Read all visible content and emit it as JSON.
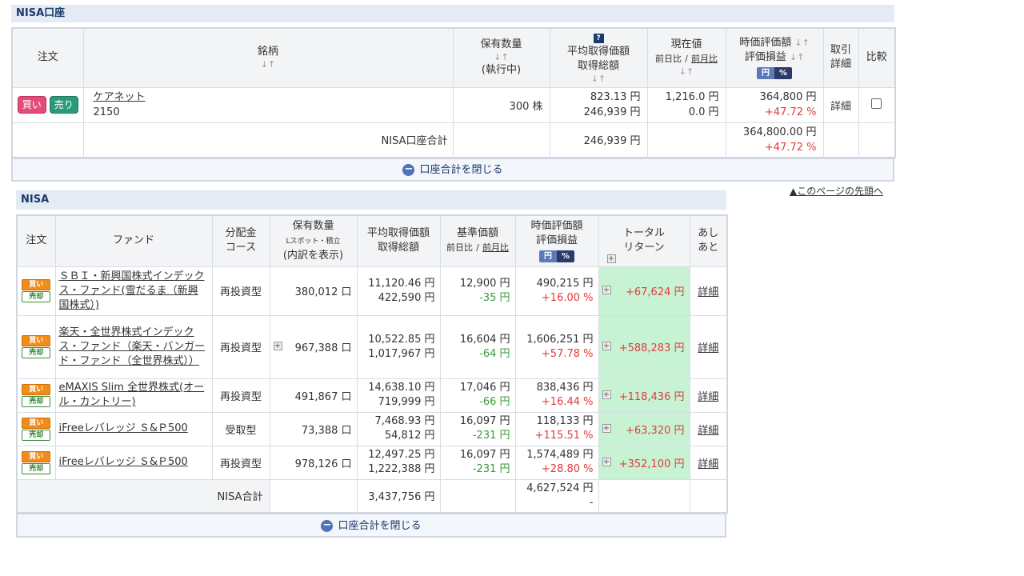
{
  "nisa_account": {
    "title": "NISA口座",
    "headers": {
      "order": "注文",
      "symbol": "銘柄",
      "holdings": "保有数量",
      "holdings_sub": "(執行中)",
      "avg_cost": "平均取得価額",
      "total_cost": "取得総額",
      "price": "現在値",
      "prev_day": "前日比",
      "prev_month": "前月比",
      "market_value": "時価評価額",
      "pl": "評価損益",
      "trade_detail": "取引詳細",
      "compare": "比較",
      "toggle_yen": "円",
      "toggle_pct": "%"
    },
    "row": {
      "buy": "買い",
      "sell": "売り",
      "name": "ケアネット",
      "code": "2150",
      "qty": "300 株",
      "avg": "823.13 円",
      "total": "246,939 円",
      "price": "1,216.0 円",
      "change": "0.0 円",
      "value": "364,800 円",
      "pl": "+47.72 %",
      "detail": "詳細"
    },
    "total_row": {
      "label": "NISA口座合計",
      "total": "246,939 円",
      "value": "364,800.00 円",
      "pl": "+47.72 %"
    },
    "close_label": "口座合計を閉じる",
    "page_top": "▲このページの先頭へ"
  },
  "nisa": {
    "title": "NISA",
    "headers": {
      "order": "注文",
      "fund": "ファンド",
      "dist_1": "分配金",
      "dist_2": "コース",
      "holdings": "保有数量",
      "holdings_sub": "Lスポット・積立",
      "holdings_detail": "(内訳を表示)",
      "avg_cost": "平均取得価額",
      "total_cost": "取得総額",
      "nav": "基準価額",
      "prev_day": "前日比",
      "prev_month": "前月比",
      "market_value": "時価評価額",
      "pl": "評価損益",
      "total_return_1": "トータル",
      "total_return_2": "リターン",
      "history_1": "あし",
      "history_2": "あと",
      "toggle_yen": "円",
      "toggle_pct": "%"
    },
    "buy_label": "買い",
    "sell_label": "売却",
    "detail_label": "詳細",
    "rows": [
      {
        "name": "ＳＢＩ・新興国株式インデックス・ファンド(雪だるま（新興国株式）)",
        "course": "再投資型",
        "qty": "380,012 口",
        "avg": "11,120.46 円",
        "total": "422,590 円",
        "nav": "12,900 円",
        "change": "-35 円",
        "value": "490,215 円",
        "pl": "+16.00 %",
        "ret": "+67,624 円"
      },
      {
        "name": "楽天・全世界株式インデックス・ファンド（楽天・バンガード・ファンド（全世界株式））",
        "course": "再投資型",
        "qty": "967,388 口",
        "avg": "10,522.85 円",
        "total": "1,017,967 円",
        "nav": "16,604 円",
        "change": "-64 円",
        "value": "1,606,251 円",
        "pl": "+57.78 %",
        "ret": "+588,283 円"
      },
      {
        "name": "eMAXIS Slim 全世界株式(オール・カントリー)",
        "course": "再投資型",
        "qty": "491,867 口",
        "avg": "14,638.10 円",
        "total": "719,999 円",
        "nav": "17,046 円",
        "change": "-66 円",
        "value": "838,436 円",
        "pl": "+16.44 %",
        "ret": "+118,436 円"
      },
      {
        "name": "iFreeレバレッジ Ｓ&Ｐ500",
        "course": "受取型",
        "qty": "73,388 口",
        "avg": "7,468.93 円",
        "total": "54,812 円",
        "nav": "16,097 円",
        "change": "-231 円",
        "value": "118,133 円",
        "pl": "+115.51 %",
        "ret": "+63,320 円"
      },
      {
        "name": "iFreeレバレッジ Ｓ&Ｐ500",
        "course": "再投資型",
        "qty": "978,126 口",
        "avg": "12,497.25 円",
        "total": "1,222,388 円",
        "nav": "16,097 円",
        "change": "-231 円",
        "value": "1,574,489 円",
        "pl": "+28.80 %",
        "ret": "+352,100 円"
      }
    ],
    "total_row": {
      "label": "NISA合計",
      "total": "3,437,756 円",
      "value": "4,627,524 円",
      "pl": "-"
    },
    "close_label": "口座合計を閉じる"
  }
}
